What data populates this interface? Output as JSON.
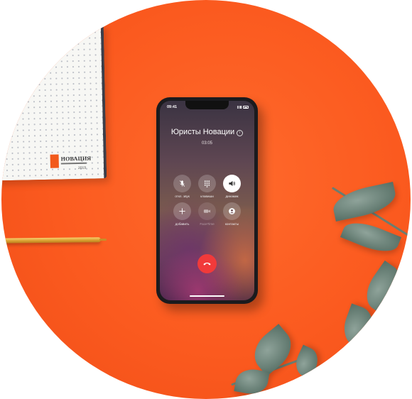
{
  "notebook": {
    "brand": "НОВАЦИЯ",
    "sub": "2019"
  },
  "phone": {
    "status_time": "09:41",
    "caller_name": "Юристы Новации",
    "info_glyph": "i",
    "call_duration": "03:05",
    "buttons": [
      {
        "label": "откл. звук",
        "icon": "mic-off-icon",
        "active": false,
        "enabled": true
      },
      {
        "label": "клавиши",
        "icon": "keypad-icon",
        "active": false,
        "enabled": true
      },
      {
        "label": "динамик",
        "icon": "speaker-icon",
        "active": true,
        "enabled": true
      },
      {
        "label": "добавить",
        "icon": "plus-icon",
        "active": false,
        "enabled": true
      },
      {
        "label": "FaceTime",
        "icon": "video-icon",
        "active": false,
        "enabled": false
      },
      {
        "label": "контакты",
        "icon": "contact-icon",
        "active": false,
        "enabled": true
      }
    ],
    "end_call_icon": "end-call-icon",
    "colors": {
      "end_call": "#f13a3a",
      "background": "#fb5a1f"
    }
  }
}
